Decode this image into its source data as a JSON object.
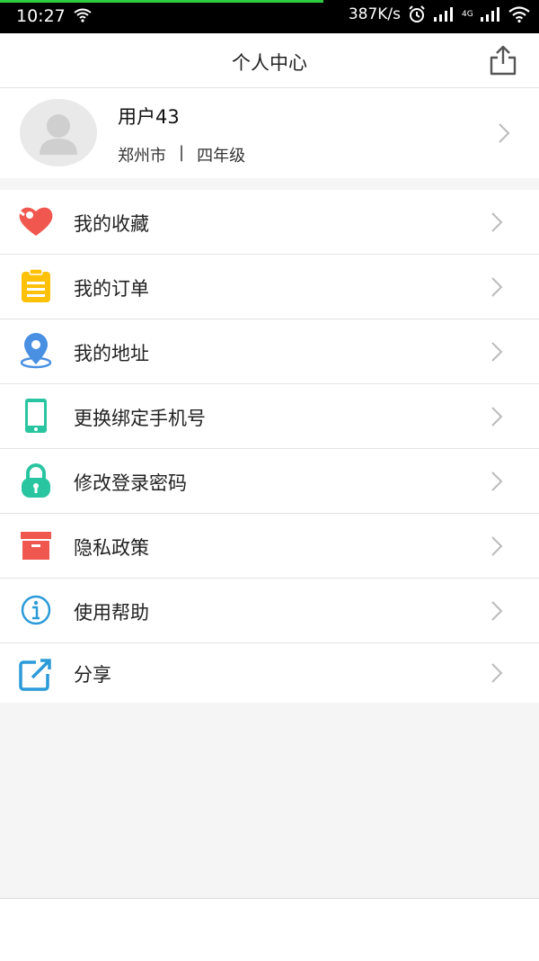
{
  "status_bar": {
    "time": "10:27",
    "network_speed": "387K/s",
    "network_type": "4G"
  },
  "header": {
    "title": "个人中心"
  },
  "profile": {
    "username": "用户43",
    "city": "郑州市",
    "separator": "|",
    "grade": "四年级"
  },
  "menu": {
    "items": [
      {
        "label": "我的收藏",
        "icon": "heart-icon",
        "color": "#f0584f"
      },
      {
        "label": "我的订单",
        "icon": "clipboard-icon",
        "color": "#ffc107"
      },
      {
        "label": "我的地址",
        "icon": "location-pin-icon",
        "color": "#4a90e2"
      },
      {
        "label": "更换绑定手机号",
        "icon": "phone-icon",
        "color": "#29c5a0"
      },
      {
        "label": "修改登录密码",
        "icon": "lock-icon",
        "color": "#29c5a0"
      },
      {
        "label": "隐私政策",
        "icon": "box-icon",
        "color": "#f0584f"
      },
      {
        "label": "使用帮助",
        "icon": "info-icon",
        "color": "#2b9ad9"
      },
      {
        "label": "分享",
        "icon": "share-icon",
        "color": "#2b9ad9"
      }
    ]
  }
}
